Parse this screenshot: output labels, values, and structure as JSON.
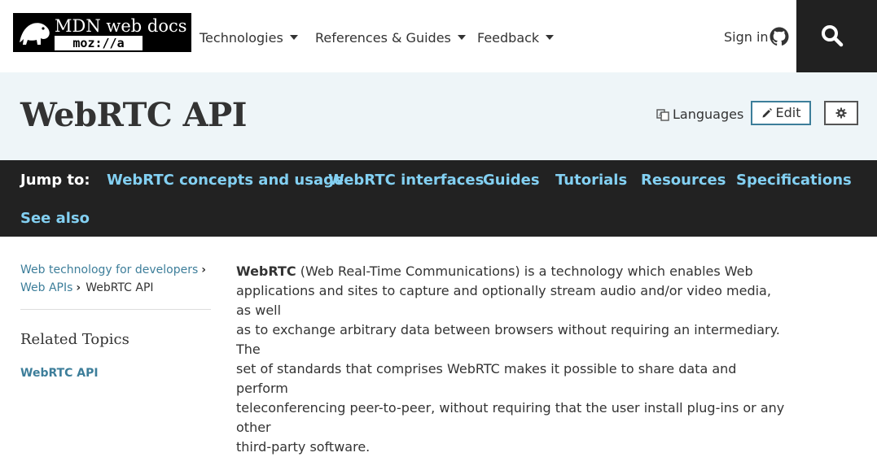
{
  "header": {
    "logo_text": "MDN web docs",
    "logo_sub": "moz://a",
    "nav": [
      {
        "label": "Technologies"
      },
      {
        "label": "References & Guides"
      },
      {
        "label": "Feedback"
      }
    ],
    "signin_label": "Sign in"
  },
  "titlebar": {
    "title": "WebRTC API",
    "languages_label": "Languages",
    "edit_label": "Edit"
  },
  "jumpbar": {
    "label": "Jump to:",
    "links": [
      "WebRTC concepts and usage",
      "WebRTC interfaces",
      "Guides",
      "Tutorials",
      "Resources",
      "Specifications",
      "See also"
    ]
  },
  "sidebar": {
    "breadcrumb": [
      "Web technology for developers",
      "Web APIs",
      "WebRTC API"
    ],
    "related_heading": "Related Topics",
    "related_link": "WebRTC API"
  },
  "content": {
    "lead_bold": "WebRTC",
    "lines": [
      " (Web Real-Time Communications) is a technology which enables Web",
      "applications and sites to capture and optionally stream audio and/or video media, as well",
      "as to exchange arbitrary data between browsers without requiring an intermediary. The",
      "set of standards that comprises WebRTC makes it possible to share data and perform",
      "teleconferencing peer-to-peer, without requiring that the user install plug-ins or any other",
      "third-party software."
    ]
  },
  "colors": {
    "link": "#3d7e9a",
    "jump_link": "#83d0f2",
    "jumpbar_bg": "#222222",
    "titleband_bg": "#eef5f8"
  }
}
